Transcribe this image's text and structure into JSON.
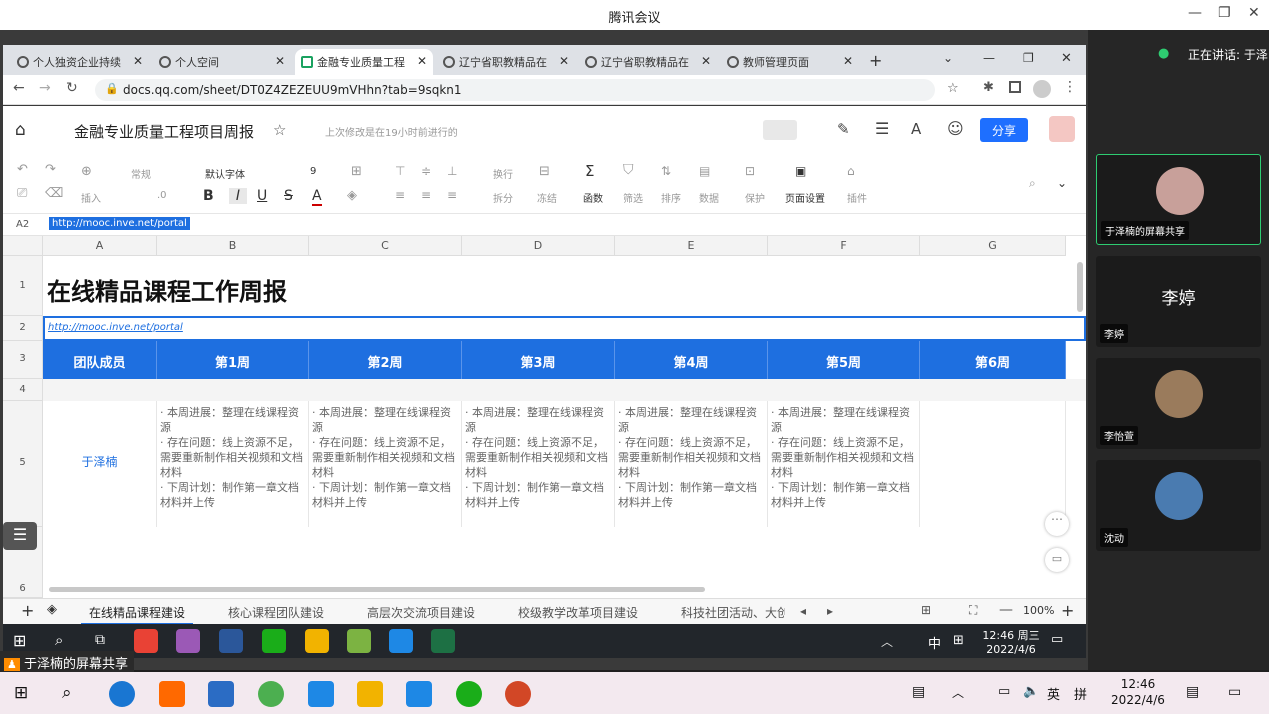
{
  "meeting": {
    "title": "腾讯会议",
    "speaking": "正在讲话: 于泽",
    "share_label": "于泽楠的屏幕共享"
  },
  "tabs": [
    {
      "label": "个人独资企业持续"
    },
    {
      "label": "个人空间"
    },
    {
      "label": "金融专业质量工程"
    },
    {
      "label": "辽宁省职教精品在"
    },
    {
      "label": "辽宁省职教精品在"
    },
    {
      "label": "教师管理页面"
    }
  ],
  "url": "docs.qq.com/sheet/DT0Z4ZEZEUU9mVHhn?tab=9sqkn1",
  "doc": {
    "title": "金融专业质量工程项目周报",
    "saved": "上次修改是在19小时前进行的",
    "share": "分享"
  },
  "toolbar": {
    "style": "常规",
    "font": "默认字体",
    "size": "9",
    "decimal": ".0",
    "insert": "插入",
    "wrap": "换行",
    "split": "拆分",
    "freeze": "冻结",
    "func": "函数",
    "filter": "筛选",
    "sort": "排序",
    "data": "数据",
    "protect": "保护",
    "page": "页面设置",
    "plugin": "插件"
  },
  "cell_ref": "A2",
  "formula": "http://mooc.inve.net/portal",
  "columns": [
    "A",
    "B",
    "C",
    "D",
    "E",
    "F",
    "G"
  ],
  "rows": [
    "1",
    "2",
    "3",
    "4",
    "5",
    "6"
  ],
  "sheet": {
    "title": "在线精品课程工作周报",
    "link": "http://mooc.inve.net/portal",
    "headers": [
      "团队成员",
      "第1周",
      "第2周",
      "第3周",
      "第4周",
      "第5周",
      "第6周"
    ],
    "member": "于泽楠",
    "report": "· 本周进展：整理在线课程资源\n· 存在问题：线上资源不足，需要重新制作相关视频和文档材料\n· 下周计划：制作第一章文档材料并上传"
  },
  "sheet_tabs": [
    "在线精品课程建设",
    "核心课程团队建设",
    "高层次交流项目建设",
    "校级教学改革项目建设",
    "科技社团活动、大创"
  ],
  "zoom": "100%",
  "inner_clock": {
    "time": "12:46 周三",
    "date": "2022/4/6"
  },
  "inner_ime": "中",
  "participants": [
    {
      "name": "于泽楠的屏幕共享"
    },
    {
      "name": "李婷",
      "big": "李婷"
    },
    {
      "name": "李怡萱"
    },
    {
      "name": "沈动"
    }
  ],
  "win_clock": {
    "time": "12:46",
    "date": "2022/4/6"
  },
  "win_ime": "英",
  "win_ime2": "拼"
}
